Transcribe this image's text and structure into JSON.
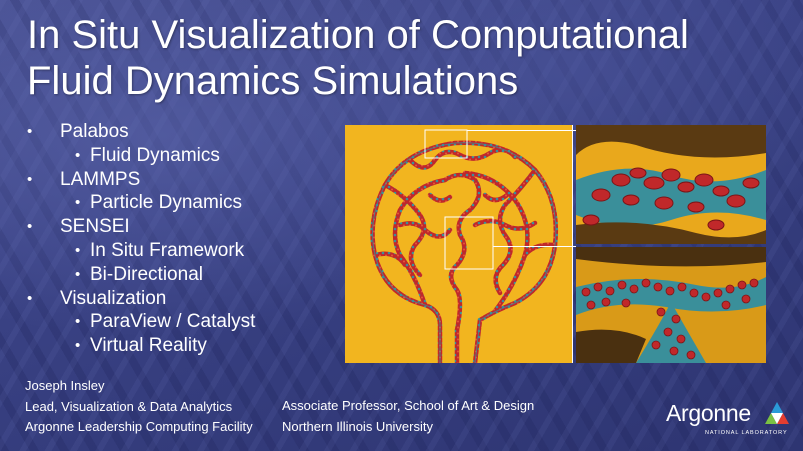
{
  "slide": {
    "title_line1": "In Situ Visualization of Computational",
    "title_line2": "Fluid Dynamics Simulations",
    "bullets": [
      {
        "level": 1,
        "text": "Palabos"
      },
      {
        "level": 2,
        "text": "Fluid Dynamics"
      },
      {
        "level": 1,
        "text": "LAMMPS"
      },
      {
        "level": 2,
        "text": "Particle Dynamics"
      },
      {
        "level": 1,
        "text": "SENSEI"
      },
      {
        "level": 2,
        "text": "In Situ Framework"
      },
      {
        "level": 2,
        "text": "Bi-Directional"
      },
      {
        "level": 1,
        "text": "Visualization"
      },
      {
        "level": 2,
        "text": "ParaView / Catalyst"
      },
      {
        "level": 2,
        "text": "Virtual Reality"
      }
    ],
    "presenter": {
      "name": "Joseph Insley",
      "role1": "Lead, Visualization & Data Analytics",
      "org1": "Argonne Leadership Computing Facility",
      "role2": "Associate Professor, School of Art & Design",
      "org2": "Northern Illinois University"
    },
    "logo": {
      "name": "Argonne",
      "subtitle": "NATIONAL LABORATORY",
      "colors": [
        "#2b9bd8",
        "#7ac143",
        "#e43d30"
      ]
    },
    "figure_colors": {
      "background_yellow": "#f2b51f",
      "vessel_red": "#c0282a",
      "vessel_teal": "#3a8f9a"
    }
  }
}
